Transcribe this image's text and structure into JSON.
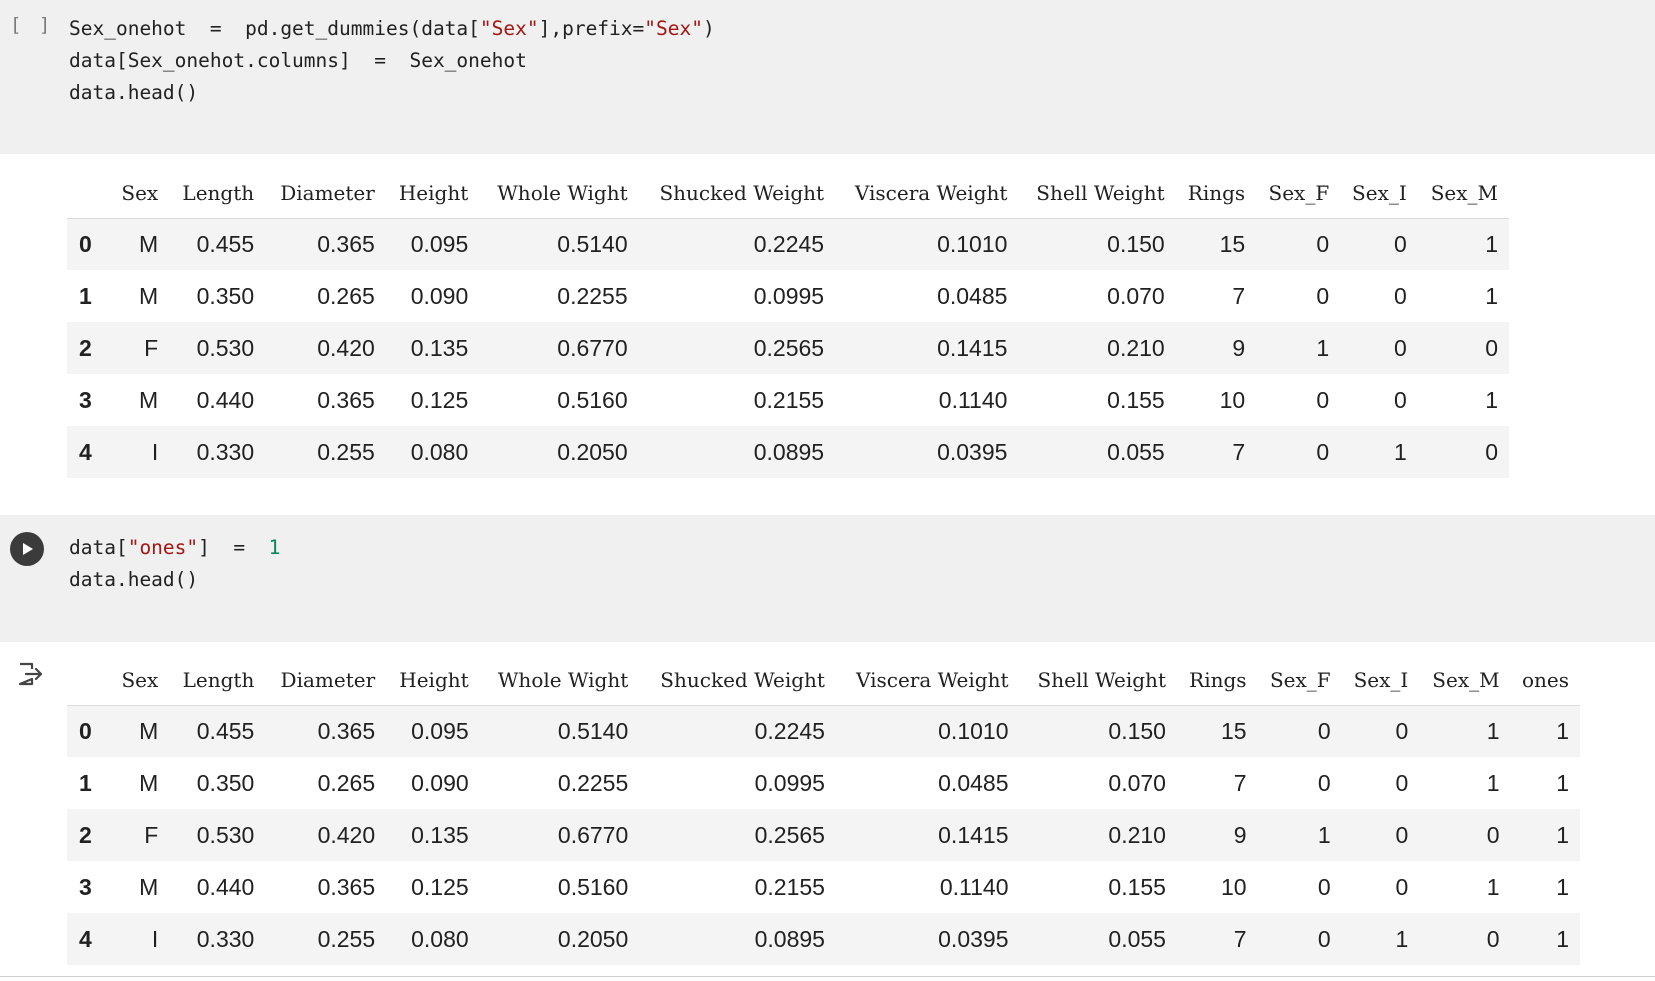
{
  "cell1": {
    "gutter": "[ ]",
    "code_lines": [
      [
        {
          "t": "Sex_onehot  =  pd.get_dummies(data["
        },
        {
          "t": "\"Sex\"",
          "c": "str"
        },
        {
          "t": "],prefix="
        },
        {
          "t": "\"Sex\"",
          "c": "str"
        },
        {
          "t": ")"
        }
      ],
      [
        {
          "t": "data[Sex_onehot.columns]  =  Sex_onehot"
        }
      ],
      [
        {
          "t": "data.head()"
        }
      ]
    ]
  },
  "table1": {
    "columns": [
      "",
      "Sex",
      "Length",
      "Diameter",
      "Height",
      "Whole Wight",
      "Shucked Weight",
      "Viscera Weight",
      "Shell Weight",
      "Rings",
      "Sex_F",
      "Sex_I",
      "Sex_M"
    ],
    "rows": [
      [
        "0",
        "M",
        "0.455",
        "0.365",
        "0.095",
        "0.5140",
        "0.2245",
        "0.1010",
        "0.150",
        "15",
        "0",
        "0",
        "1"
      ],
      [
        "1",
        "M",
        "0.350",
        "0.265",
        "0.090",
        "0.2255",
        "0.0995",
        "0.0485",
        "0.070",
        "7",
        "0",
        "0",
        "1"
      ],
      [
        "2",
        "F",
        "0.530",
        "0.420",
        "0.135",
        "0.6770",
        "0.2565",
        "0.1415",
        "0.210",
        "9",
        "1",
        "0",
        "0"
      ],
      [
        "3",
        "M",
        "0.440",
        "0.365",
        "0.125",
        "0.5160",
        "0.2155",
        "0.1140",
        "0.155",
        "10",
        "0",
        "0",
        "1"
      ],
      [
        "4",
        "I",
        "0.330",
        "0.255",
        "0.080",
        "0.2050",
        "0.0895",
        "0.0395",
        "0.055",
        "7",
        "0",
        "1",
        "0"
      ]
    ]
  },
  "cell2": {
    "run_button_icon": "play-icon",
    "output_icon": "output-redirect-icon",
    "code_lines": [
      [
        {
          "t": "data["
        },
        {
          "t": "\"ones\"",
          "c": "str"
        },
        {
          "t": "]  =  "
        },
        {
          "t": "1",
          "c": "num"
        }
      ],
      [
        {
          "t": "data.head()"
        }
      ]
    ]
  },
  "table2": {
    "columns": [
      "",
      "Sex",
      "Length",
      "Diameter",
      "Height",
      "Whole Wight",
      "Shucked Weight",
      "Viscera Weight",
      "Shell Weight",
      "Rings",
      "Sex_F",
      "Sex_I",
      "Sex_M",
      "ones"
    ],
    "rows": [
      [
        "0",
        "M",
        "0.455",
        "0.365",
        "0.095",
        "0.5140",
        "0.2245",
        "0.1010",
        "0.150",
        "15",
        "0",
        "0",
        "1",
        "1"
      ],
      [
        "1",
        "M",
        "0.350",
        "0.265",
        "0.090",
        "0.2255",
        "0.0995",
        "0.0485",
        "0.070",
        "7",
        "0",
        "0",
        "1",
        "1"
      ],
      [
        "2",
        "F",
        "0.530",
        "0.420",
        "0.135",
        "0.6770",
        "0.2565",
        "0.1415",
        "0.210",
        "9",
        "1",
        "0",
        "0",
        "1"
      ],
      [
        "3",
        "M",
        "0.440",
        "0.365",
        "0.125",
        "0.5160",
        "0.2155",
        "0.1140",
        "0.155",
        "10",
        "0",
        "0",
        "1",
        "1"
      ],
      [
        "4",
        "I",
        "0.330",
        "0.255",
        "0.080",
        "0.2050",
        "0.0895",
        "0.0395",
        "0.055",
        "7",
        "0",
        "1",
        "0",
        "1"
      ]
    ]
  },
  "colors": {
    "cell_bg": "#f0f0f0",
    "string": "#a31515",
    "number": "#098658",
    "run_button": "#3b3b3b",
    "row_stripe": "#f4f4f4"
  }
}
